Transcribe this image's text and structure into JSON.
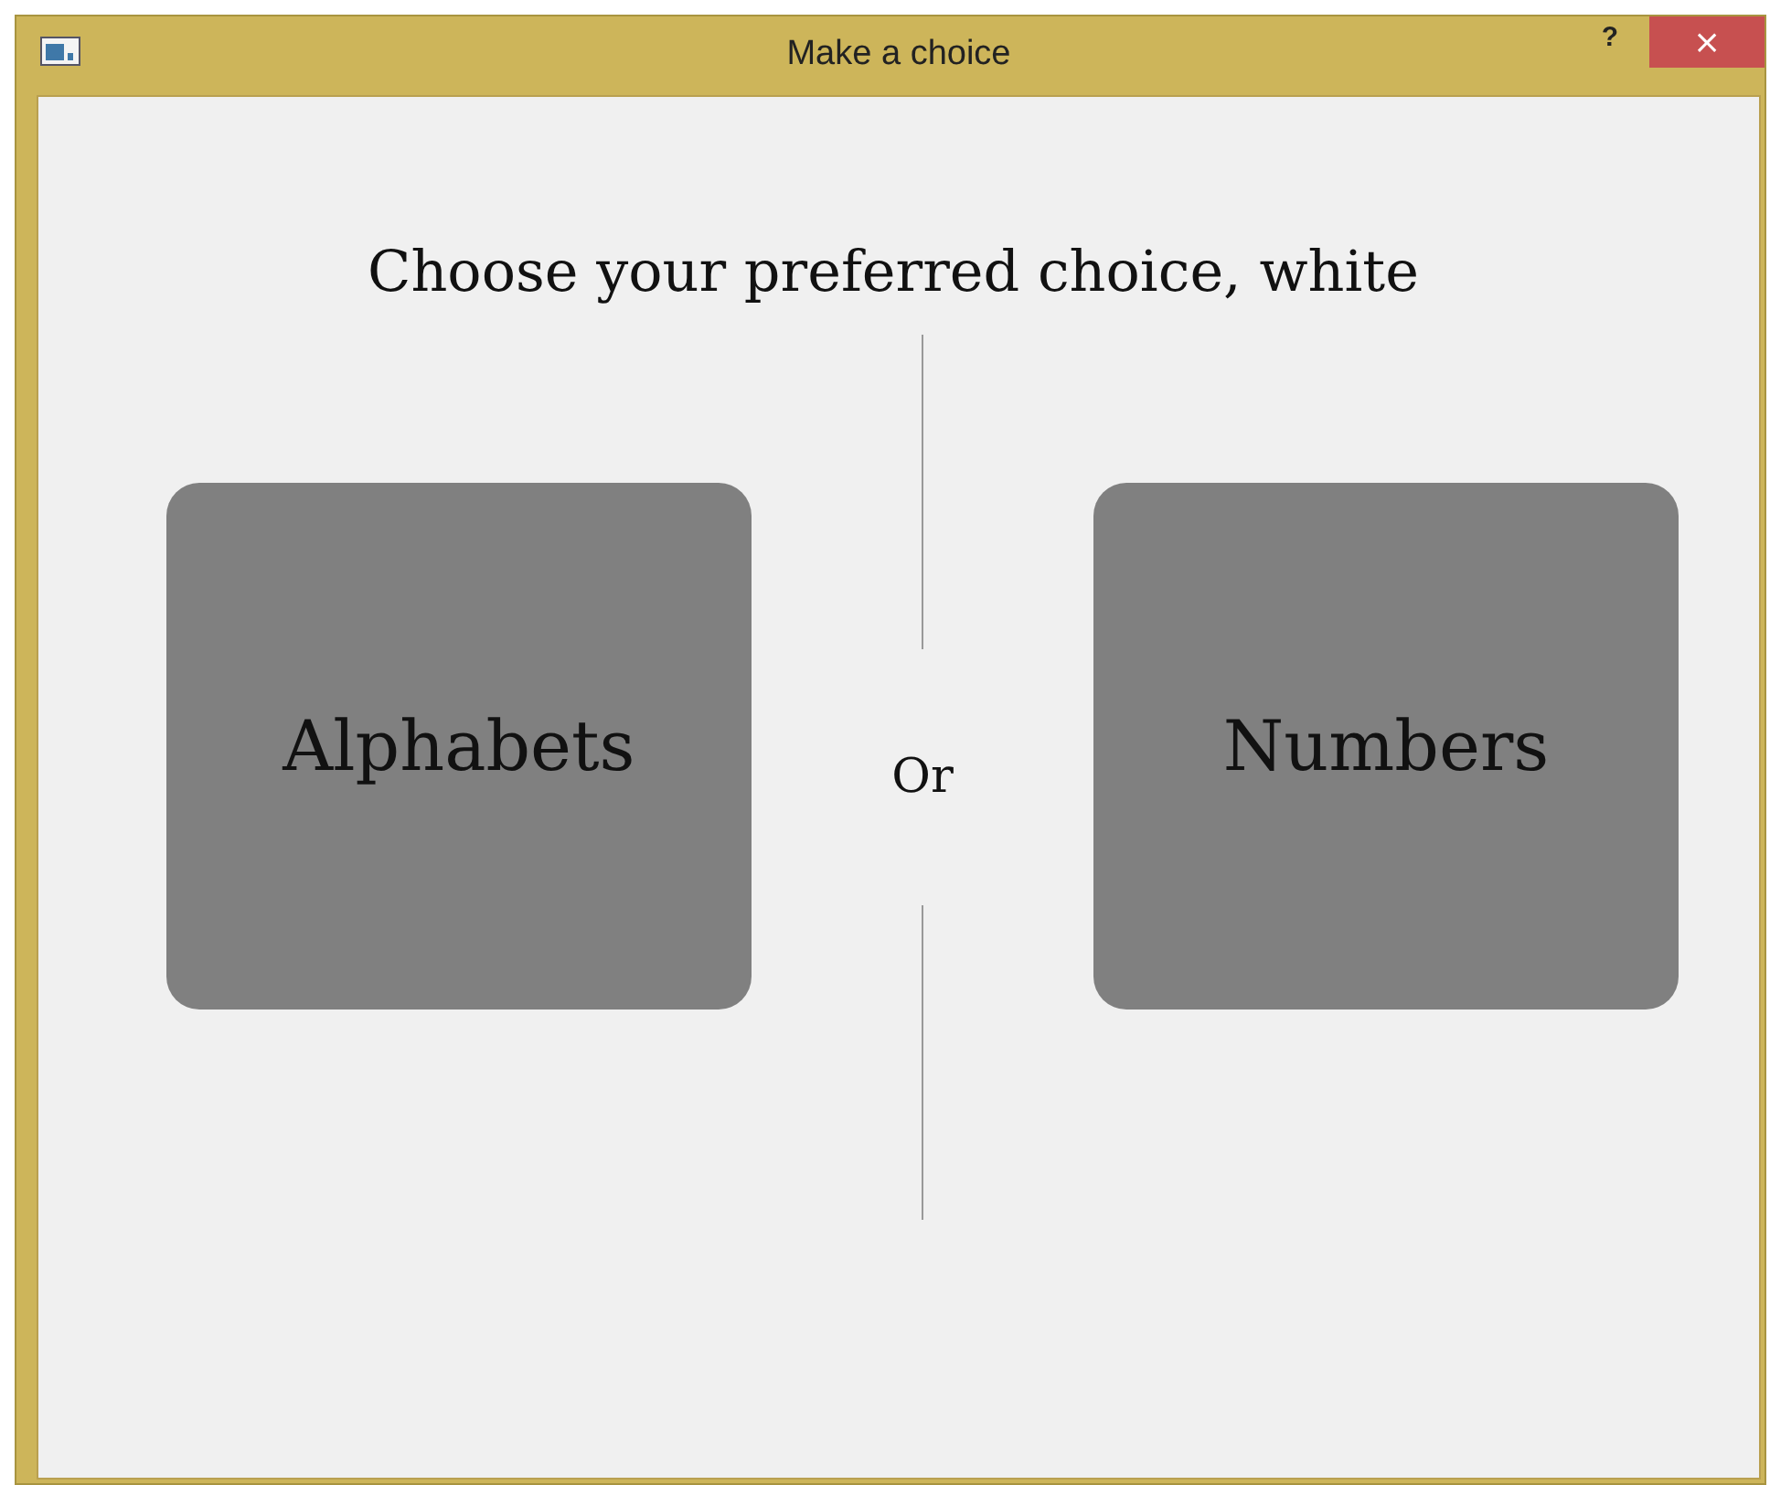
{
  "window": {
    "title": "Make a choice",
    "help_button": "?",
    "close_button": "×"
  },
  "prompt": "Choose your preferred choice, white",
  "choices": [
    {
      "label": "Alphabets"
    },
    {
      "label": "Numbers"
    }
  ],
  "separator": "Or"
}
